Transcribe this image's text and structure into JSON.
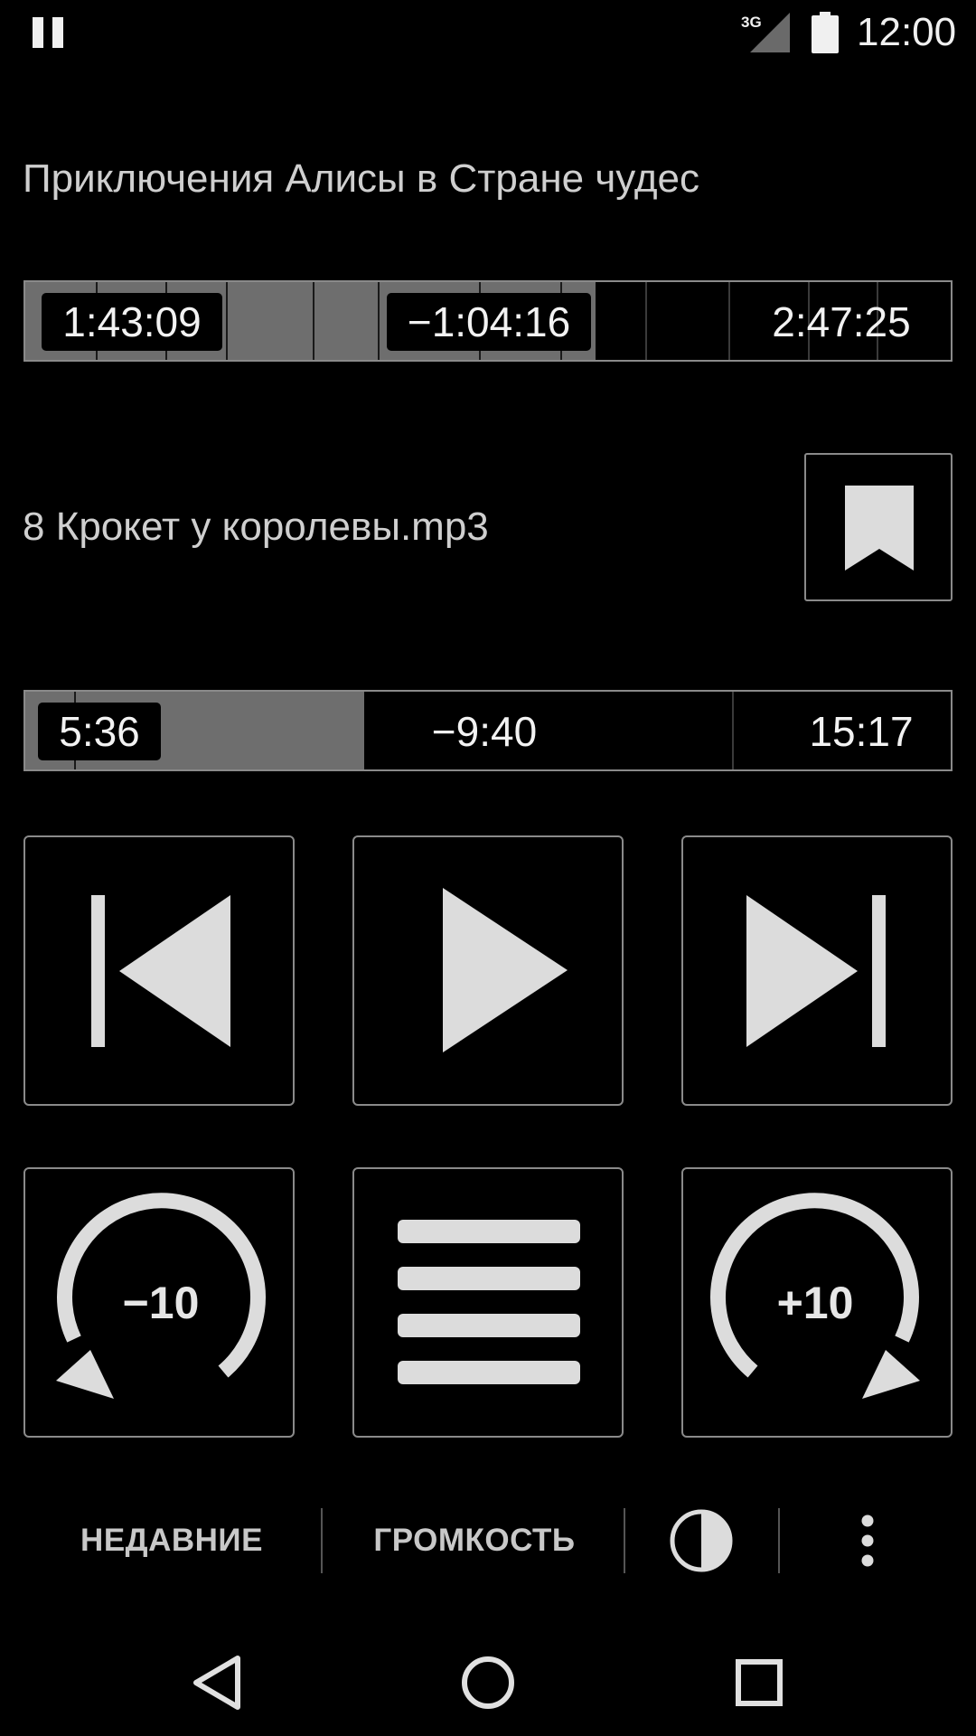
{
  "status_bar": {
    "time": "12:00",
    "network": "3G",
    "icons": [
      "pause-icon",
      "signal-icon",
      "battery-icon"
    ]
  },
  "book": {
    "title": "Приключения Алисы в Стране чудес",
    "elapsed": "1:43:09",
    "remaining": "−1:04:16",
    "total": "2:47:25",
    "progress": 0.616
  },
  "track": {
    "title": "8 Крокет у королевы.mp3",
    "elapsed": "5:36",
    "remaining": "−9:40",
    "total": "15:17",
    "progress": 0.366
  },
  "controls": {
    "prev_icon": "skip-previous-icon",
    "play_icon": "play-icon",
    "next_icon": "skip-next-icon",
    "rewind_label": "−10",
    "playlist_icon": "playlist-icon",
    "forward_label": "+10",
    "bookmark_icon": "bookmark-icon"
  },
  "action_bar": {
    "recent_label": "НЕДАВНИЕ",
    "volume_label": "ГРОМКОСТЬ",
    "theme_icon": "contrast-icon",
    "overflow_icon": "more-vert-icon"
  },
  "nav_bar": {
    "icons": [
      "back-icon",
      "home-icon",
      "recents-icon"
    ]
  },
  "colors": {
    "background": "#000000",
    "progress_fill": "#6e6e6e",
    "border": "#8a8a8a",
    "icon": "#dcdcdc",
    "text": "#cfcfcf"
  }
}
